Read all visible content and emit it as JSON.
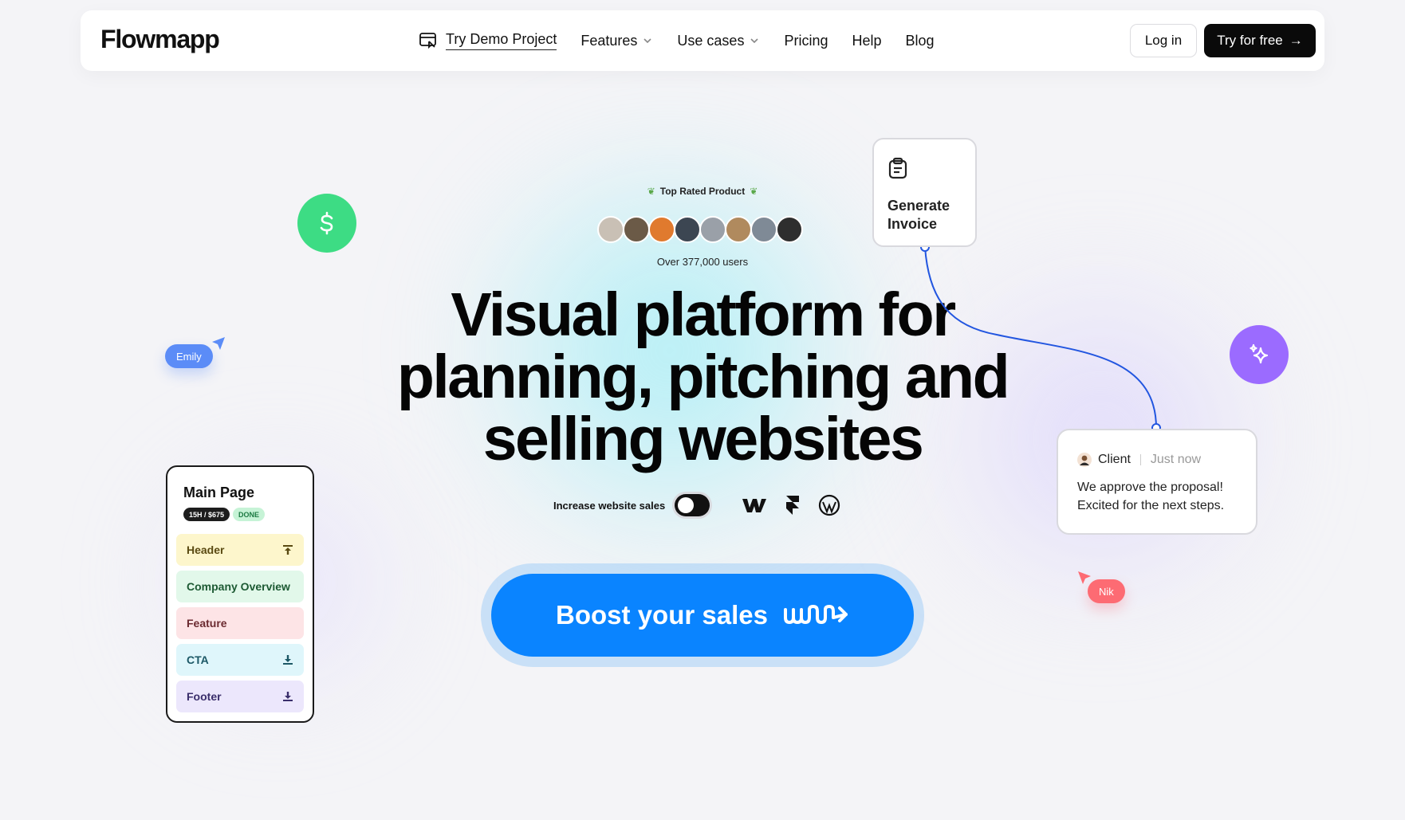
{
  "nav": {
    "logo": "Flowmapp",
    "demo": "Try Demo Project",
    "features": "Features",
    "use_cases": "Use cases",
    "pricing": "Pricing",
    "help": "Help",
    "blog": "Blog",
    "login": "Log in",
    "try_free": "Try for free",
    "try_arrow": "→"
  },
  "hero": {
    "rated": "Top Rated Product",
    "users": "Over 377,000 users",
    "headline_1": "Visual platform for",
    "headline_2": "planning, pitching and",
    "headline_3": "selling websites",
    "toggle_label": "Increase website sales",
    "cta": "Boost your sales"
  },
  "floating": {
    "emily": "Emily",
    "nik": "Nik",
    "invoice": "Generate Invoice",
    "client_name": "Client",
    "client_time": "Just now",
    "client_msg": "We approve the proposal! Excited for the next steps."
  },
  "page_card": {
    "title": "Main Page",
    "badge_cost": "15H / $675",
    "badge_status": "DONE",
    "sections": [
      {
        "label": "Header"
      },
      {
        "label": "Company Overview"
      },
      {
        "label": "Feature"
      },
      {
        "label": "CTA"
      },
      {
        "label": "Footer"
      }
    ]
  },
  "colors": {
    "cta_blue": "#0a84ff",
    "dollar_green": "#3ddc84",
    "sparkle_purple": "#9b6bff",
    "emily_blue": "#5b8cf7",
    "nik_red": "#fd6b73"
  }
}
